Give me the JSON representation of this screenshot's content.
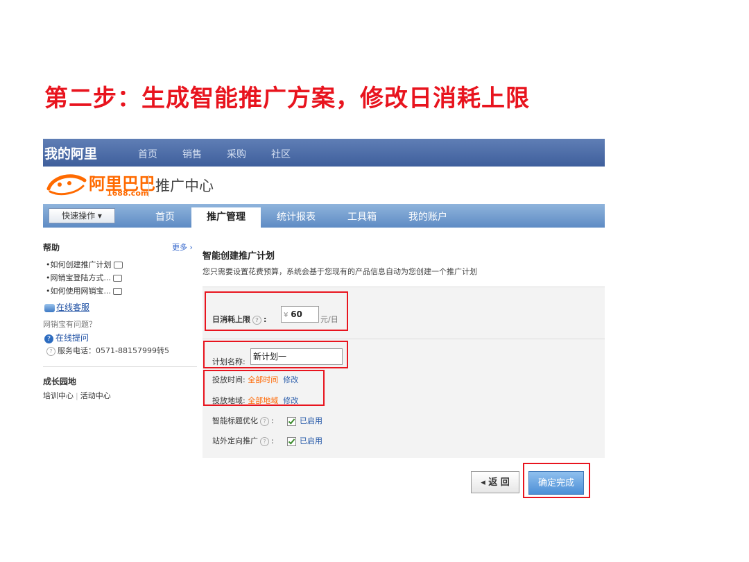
{
  "slide": {
    "title": "第二步：生成智能推广方案，修改日消耗上限"
  },
  "topbar": {
    "brand": "我的阿里",
    "nav": [
      "首页",
      "销售",
      "采购",
      "社区"
    ]
  },
  "logo": {
    "cn": "阿里巴巴",
    "en": "1688.com",
    "center": "推广中心"
  },
  "tabs": {
    "quick_action": "快速操作 ▾",
    "items": [
      {
        "label": "首页",
        "active": false
      },
      {
        "label": "推广管理",
        "active": true
      },
      {
        "label": "统计报表",
        "active": false
      },
      {
        "label": "工具箱",
        "active": false
      },
      {
        "label": "我的账户",
        "active": false
      }
    ]
  },
  "sidebar": {
    "help_title": "帮助",
    "more": "更多 ›",
    "help_links": [
      "•如何创建推广计划",
      "•网销宝登陆方式...",
      "•如何使用网销宝..."
    ],
    "online_service": "在线客服",
    "question": "网销宝有问题？",
    "online_ask": "在线提问",
    "hotline": "服务电话：0571-88157999转5",
    "growth_title": "成长园地",
    "growth_links": [
      "培训中心",
      "活动中心"
    ]
  },
  "main": {
    "title": "智能创建推广计划",
    "desc": "您只需要设置花费预算，系统会基于您现有的产品信息自动为您创建一个推广计划",
    "daily_limit": {
      "label": "日消耗上限",
      "currency": "¥",
      "value": "60",
      "unit": "元/日"
    },
    "plan_name": {
      "label": "计划名称:",
      "value": "新计划一"
    },
    "schedule": {
      "label": "投放时间:",
      "value": "全部时间",
      "edit": "修改"
    },
    "region": {
      "label": "投放地域:",
      "value": "全部地域",
      "edit": "修改"
    },
    "smart_title": {
      "label": "智能标题优化",
      "status": "已启用"
    },
    "offsite": {
      "label": "站外定向推广",
      "status": "已启用"
    }
  },
  "buttons": {
    "back": "◂ 返 回",
    "confirm": "确定完成"
  },
  "colors": {
    "highlight": "#e8141e",
    "brand_orange": "#ff6a00",
    "nav_blue": "#4a6aa8"
  }
}
